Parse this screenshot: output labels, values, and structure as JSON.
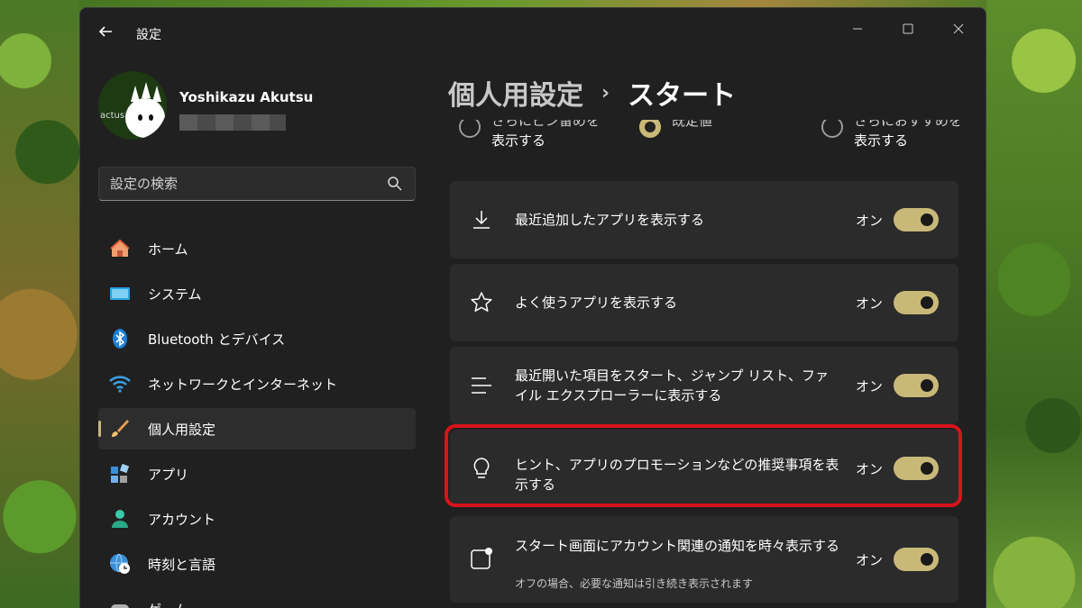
{
  "window": {
    "title": "設定"
  },
  "user": {
    "name": "Yoshikazu Akutsu",
    "avatar_text": "actus"
  },
  "search": {
    "placeholder": "設定の検索"
  },
  "sidebar": {
    "items": [
      {
        "label": "ホーム",
        "icon": "home-icon"
      },
      {
        "label": "システム",
        "icon": "system-icon"
      },
      {
        "label": "Bluetooth とデバイス",
        "icon": "bluetooth-icon"
      },
      {
        "label": "ネットワークとインターネット",
        "icon": "wifi-icon"
      },
      {
        "label": "個人用設定",
        "icon": "brush-icon",
        "selected": true
      },
      {
        "label": "アプリ",
        "icon": "apps-icon"
      },
      {
        "label": "アカウント",
        "icon": "account-icon"
      },
      {
        "label": "時刻と言語",
        "icon": "globe-clock-icon"
      },
      {
        "label": "ゲーム",
        "icon": "game-icon"
      }
    ]
  },
  "breadcrumb": {
    "parent": "個人用設定",
    "separator": "›",
    "current": "スタート"
  },
  "layout_options": [
    {
      "line1": "さらにピン留めを",
      "line2": "表示する",
      "checked": false
    },
    {
      "line1": "既定値",
      "line2": "",
      "checked": true
    },
    {
      "line1": "さらにおすすめを",
      "line2": "表示する",
      "checked": false
    }
  ],
  "settings": [
    {
      "title": "最近追加したアプリを表示する",
      "desc": "",
      "state": "オン",
      "icon": "download-icon"
    },
    {
      "title": "よく使うアプリを表示する",
      "desc": "",
      "state": "オン",
      "icon": "star-icon"
    },
    {
      "title": "最近開いた項目をスタート、ジャンプ リスト、ファイル エクスプローラーに表示する",
      "desc": "",
      "state": "オン",
      "icon": "list-icon"
    },
    {
      "title": "ヒント、アプリのプロモーションなどの推奨事項を表示する",
      "desc": "",
      "state": "オン",
      "icon": "lightbulb-icon"
    },
    {
      "title": "スタート画面にアカウント関連の通知を時々表示する",
      "desc": "オフの場合、必要な通知は引き続き表示されます",
      "state": "オン",
      "icon": "notification-icon"
    }
  ],
  "colors": {
    "accent": "#c9b978",
    "highlight": "#d8131a",
    "background": "#202020",
    "card": "#2b2b2b"
  }
}
